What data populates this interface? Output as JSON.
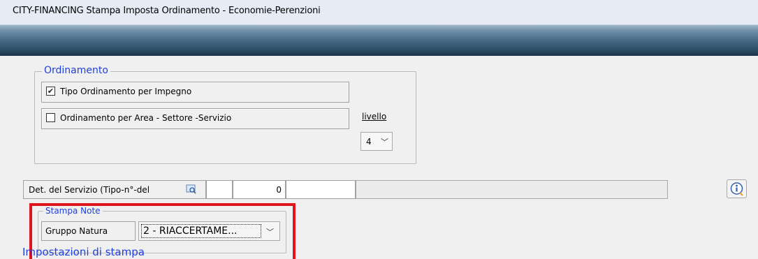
{
  "window": {
    "title": "CITY-FINANCING  Stampa  Imposta Ordinamento - Economie-Perenzioni"
  },
  "ordinamento": {
    "legend": "Ordinamento",
    "options": [
      {
        "label": "Tipo Ordinamento per Impegno",
        "checked": true
      },
      {
        "label": "Ordinamento per Area - Settore -Servizio",
        "checked": false
      }
    ],
    "livello_label": "livello",
    "livello_value": "4"
  },
  "det_servizio": {
    "label": "Det. del Servizio (Tipo-n°-del",
    "field1": "",
    "field2": "0",
    "field3": "",
    "description": ""
  },
  "stampa_note": {
    "legend": "Stampa Note",
    "gruppo_label": "Gruppo Natura",
    "gruppo_value": "2 - RIACCERTAME..."
  },
  "impostazioni": {
    "legend": "Impostazioni di stampa"
  },
  "icons": {
    "checked": "checkbox-checked-icon",
    "unchecked": "checkbox-unchecked-icon",
    "dropdown": "chevron-down-icon",
    "lookup": "lookup-icon",
    "info": "info-icon"
  },
  "colors": {
    "legend_blue": "#1f3fe0",
    "highlight_red": "#e3131b",
    "banner_dark": "#1c3447"
  }
}
